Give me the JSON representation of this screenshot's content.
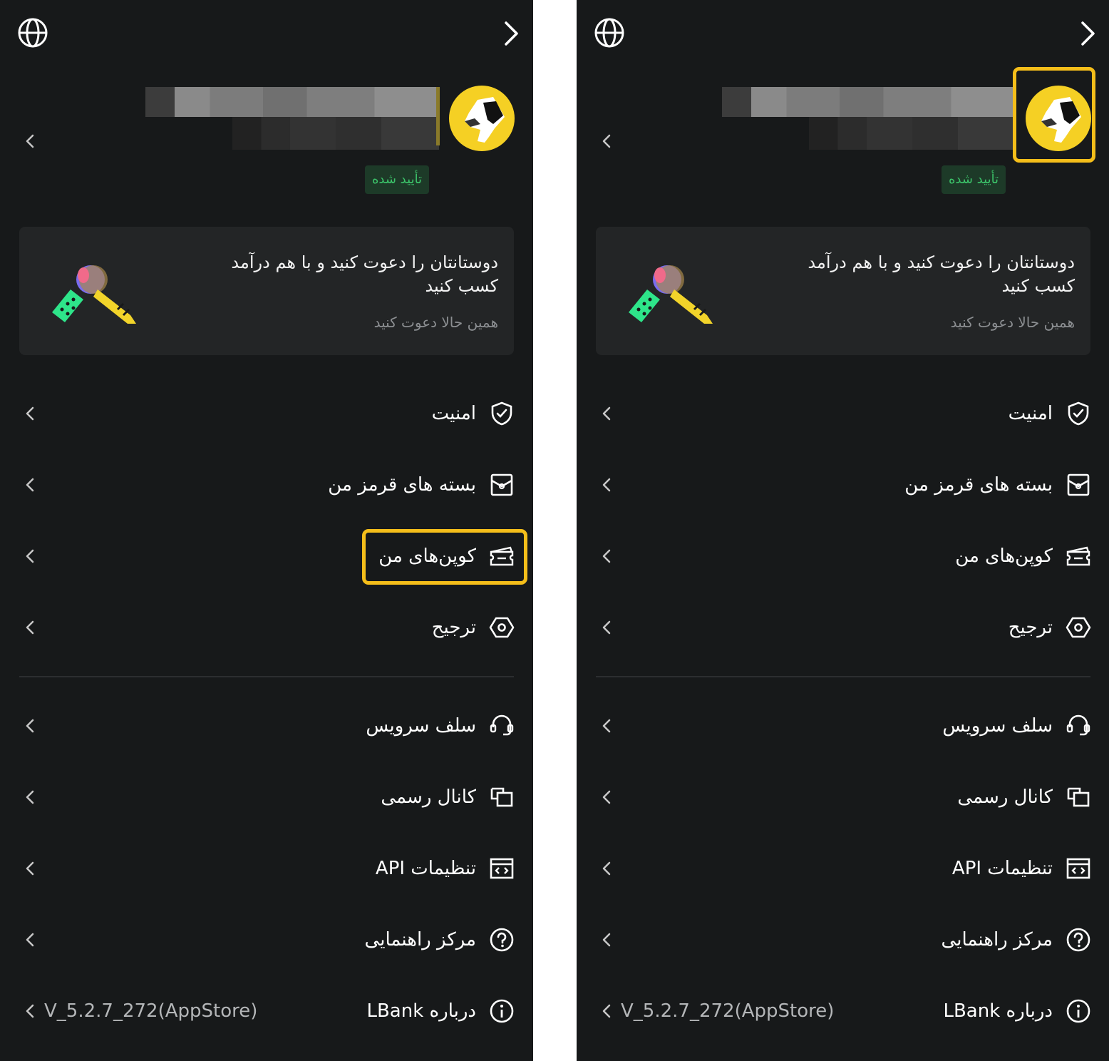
{
  "colors": {
    "panel_bg": "#17191a",
    "card_bg": "#232526",
    "highlight": "#f5be1a",
    "verified_bg": "#1d3a28",
    "verified_text": "#3cc46a",
    "avatar_bg": "#f5d024"
  },
  "profile": {
    "verified_label": "تأیید شده",
    "avatar_icon": "avatar-icon"
  },
  "invite_card": {
    "title": "دوستانتان را دعوت کنید و با هم درآمد کسب کنید",
    "subtitle": "همین حالا دعوت کنید"
  },
  "menu": {
    "items": [
      {
        "label": "امنیت",
        "icon": "shield-check-icon"
      },
      {
        "label": "بسته های قرمز من",
        "icon": "red-packet-icon"
      },
      {
        "label": "کوپن‌های من",
        "icon": "coupon-icon"
      },
      {
        "label": "ترجیح",
        "icon": "settings-hexagon-icon"
      },
      {
        "label": "سلف سرویس",
        "icon": "headset-icon"
      },
      {
        "label": "کانال رسمی",
        "icon": "channel-icon"
      },
      {
        "label": "تنظیمات API",
        "icon": "api-code-icon"
      },
      {
        "label": "مرکز راهنمایی",
        "icon": "help-circle-icon"
      },
      {
        "label": "درباره LBank",
        "icon": "info-circle-icon"
      }
    ],
    "version": "V_5.2.7_272(AppStore)"
  },
  "panels": [
    {
      "id": "left",
      "highlight": "coupons"
    },
    {
      "id": "right",
      "highlight": "avatar"
    }
  ]
}
